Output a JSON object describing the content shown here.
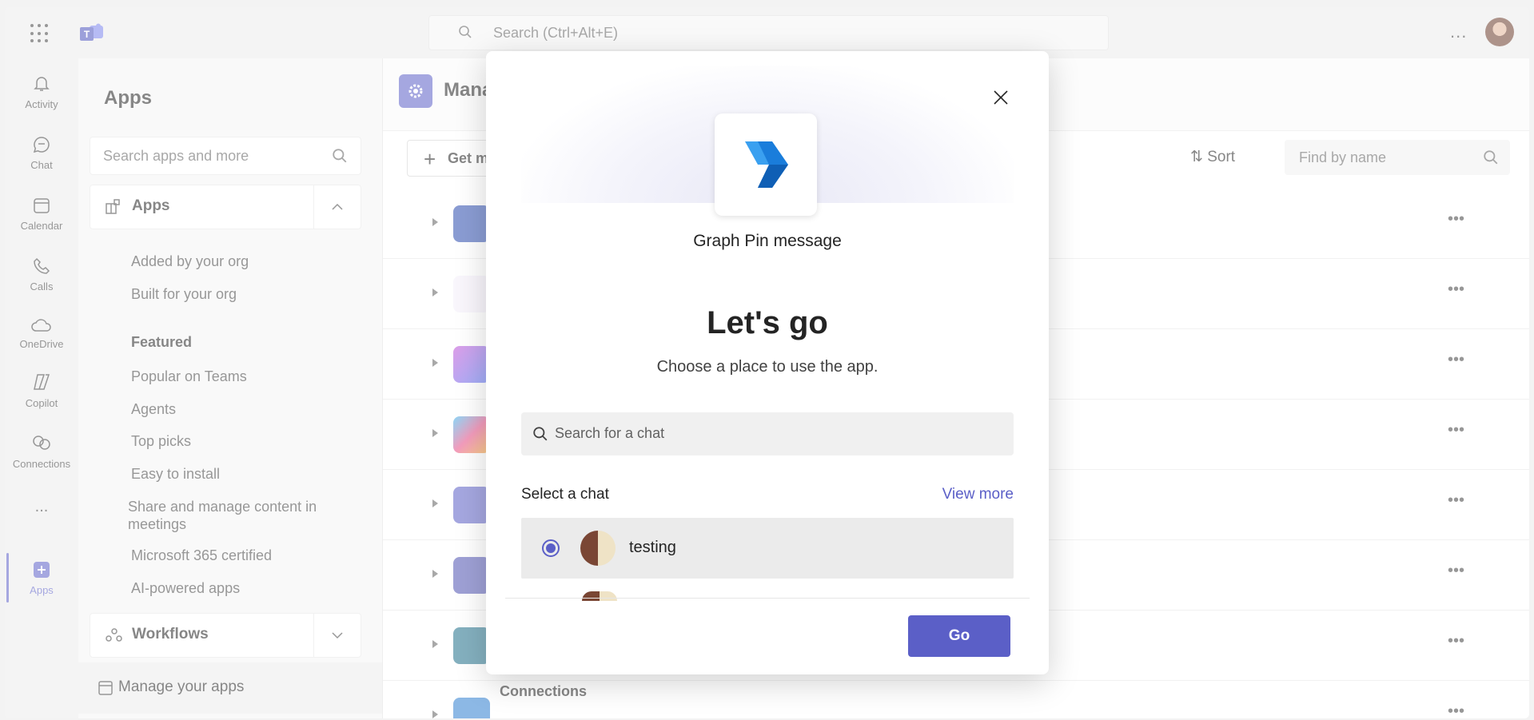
{
  "topbar": {
    "search_placeholder": "Search (Ctrl+Alt+E)",
    "more_label": "..."
  },
  "rail": {
    "items": [
      {
        "label": "Activity",
        "icon": "bell-icon"
      },
      {
        "label": "Chat",
        "icon": "chat-icon"
      },
      {
        "label": "Calendar",
        "icon": "calendar-icon"
      },
      {
        "label": "Calls",
        "icon": "phone-icon"
      },
      {
        "label": "OneDrive",
        "icon": "cloud-icon"
      },
      {
        "label": "Copilot",
        "icon": "copilot-icon"
      },
      {
        "label": "Connections",
        "icon": "connections-icon"
      },
      {
        "label": "Apps",
        "icon": "apps-icon"
      }
    ],
    "more_label": "..."
  },
  "sidebar": {
    "title": "Apps",
    "search_placeholder": "Search apps and more",
    "apps_section": "Apps",
    "links": [
      "Added by your org",
      "Built for your org"
    ],
    "featured_heading": "Featured",
    "featured": [
      "Popular on Teams",
      "Agents",
      "Top picks",
      "Easy to install",
      "Share and manage content in meetings",
      "Microsoft 365 certified",
      "AI-powered apps"
    ],
    "workflows_section": "Workflows",
    "manage_label": "Manage your apps"
  },
  "main": {
    "title": "Mana",
    "get_more_label": "Get m",
    "sort_label": "Sort",
    "find_placeholder": "Find by name",
    "last_row_name": "Connections"
  },
  "dialog": {
    "app_name": "Graph Pin message",
    "heading": "Let's go",
    "subheading": "Choose a place to use the app.",
    "chat_search_placeholder": "Search for a chat",
    "select_label": "Select a chat",
    "view_more_label": "View more",
    "chats": [
      {
        "name": "testing",
        "selected": true
      }
    ],
    "go_label": "Go"
  },
  "colors": {
    "accent": "#5b5fc7"
  }
}
